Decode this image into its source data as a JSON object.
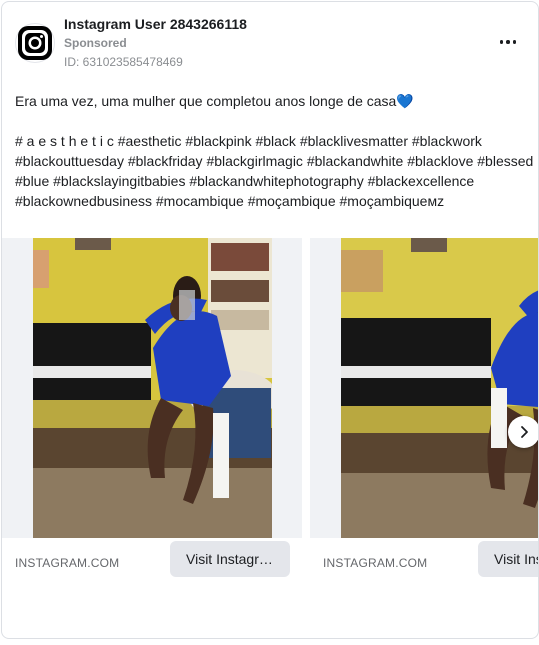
{
  "post": {
    "user_name": "Instagram User 2843266118",
    "sponsored_label": "Sponsored",
    "ad_id": "ID: 631023585478469",
    "caption_line1": "Era uma vez, uma mulher que completou anos longe de casa",
    "caption_heart": "💙",
    "caption_hashtags": "# a e s t h e t i c #aesthetic #blackpink #black #blacklivesmatter #blackwork #blackouttuesday #blackfriday #blackgirlmagic #blackandwhite #blacklove #blessed #blue #blackslayingitbabies #blackandwhitephotography #blackexcellence #blackownedbusiness #mocambique #moçambique #moçambiqueмz"
  },
  "carousel": {
    "cards": [
      {
        "domain": "INSTAGRAM.COM",
        "cta": "Visit Instagr…"
      },
      {
        "domain": "INSTAGRAM.COM",
        "cta": "Visit Ins"
      }
    ]
  },
  "icons": {
    "avatar": "instagram-logo-icon",
    "more": "more-options-icon",
    "next": "chevron-right-icon"
  }
}
